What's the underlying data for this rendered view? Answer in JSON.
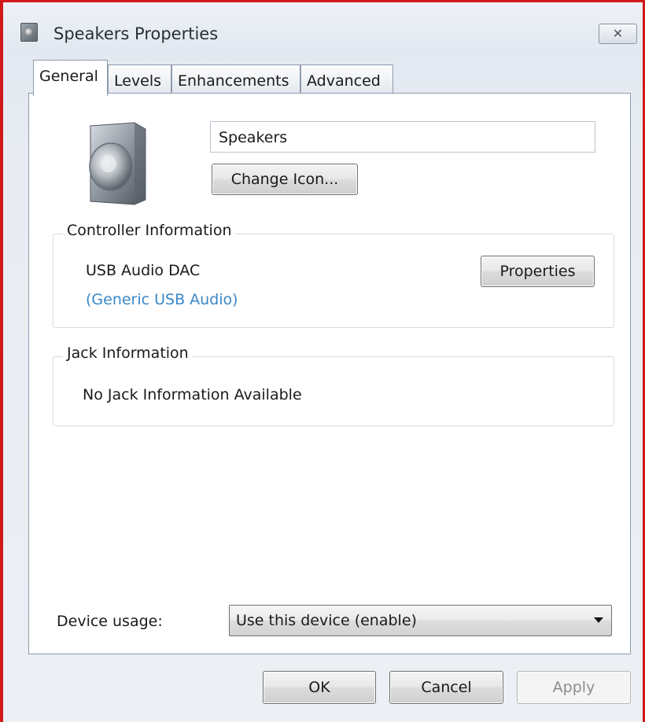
{
  "window": {
    "title": "Speakers Properties",
    "close_glyph": "✕"
  },
  "tabs": [
    {
      "label": "General",
      "active": true
    },
    {
      "label": "Levels",
      "active": false
    },
    {
      "label": "Enhancements",
      "active": false
    },
    {
      "label": "Advanced",
      "active": false
    }
  ],
  "general": {
    "device_icon": "speaker-icon",
    "device_name": "Speakers",
    "change_icon_label": "Change Icon...",
    "controller": {
      "legend": "Controller Information",
      "name": "USB Audio DAC",
      "driver": "(Generic USB Audio)",
      "properties_label": "Properties"
    },
    "jack": {
      "legend": "Jack Information",
      "text": "No Jack Information Available"
    },
    "device_usage": {
      "label": "Device usage:",
      "selected": "Use this device (enable)"
    }
  },
  "footer": {
    "ok_label": "OK",
    "cancel_label": "Cancel",
    "apply_label": "Apply"
  },
  "colors": {
    "link": "#3a87c8",
    "border_highlight": "#d0191b"
  }
}
